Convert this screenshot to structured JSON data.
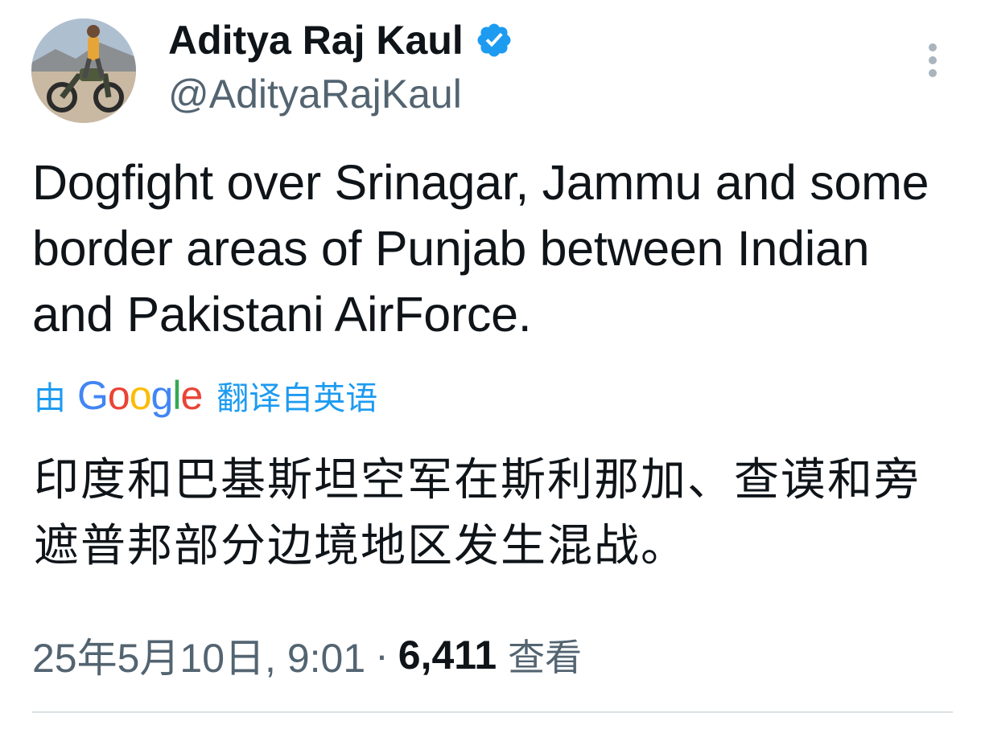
{
  "author": {
    "display_name": "Aditya Raj Kaul",
    "handle": "@AdityaRajKaul",
    "verified_badge_icon": "verified-badge-icon",
    "avatar_icon": "avatar-photo"
  },
  "tweet": {
    "text": "Dogfight over Srinagar, Jammu and some border areas of Punjab between Indian and Pakistani AirForce.",
    "translation_prefix": "由",
    "translation_provider": "Google",
    "translation_suffix": "翻译自英语",
    "translated_text": "印度和巴基斯坦空军在斯利那加、查谟和旁遮普邦部分边境地区发生混战。"
  },
  "meta": {
    "timestamp": "25年5月10日, 9:01",
    "separator": "·",
    "views_count": "6,411",
    "views_label": "查看"
  },
  "colors": {
    "accent": "#1d9bf0",
    "text": "#0f1419",
    "secondary": "#536471"
  },
  "icons": {
    "more": "more-vertical-icon"
  }
}
